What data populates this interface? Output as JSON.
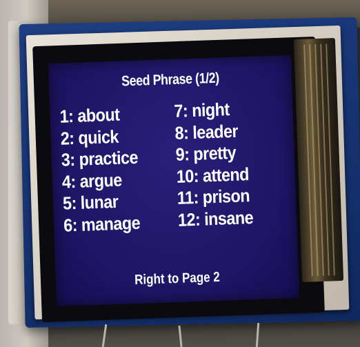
{
  "screen": {
    "title": "Seed Phrase (1/2)",
    "words_left": [
      "1: about",
      "2: quick",
      "3: practice",
      "4: argue",
      "5: lunar",
      "6: manage"
    ],
    "words_right": [
      "7: night",
      "8: leader",
      "9: pretty",
      "10: attend",
      "11: prison",
      "12: insane"
    ],
    "footer": "Right to Page 2"
  },
  "colors": {
    "screen_background": "#1f1667",
    "text": "#ffffff",
    "pcb": "#173474"
  }
}
